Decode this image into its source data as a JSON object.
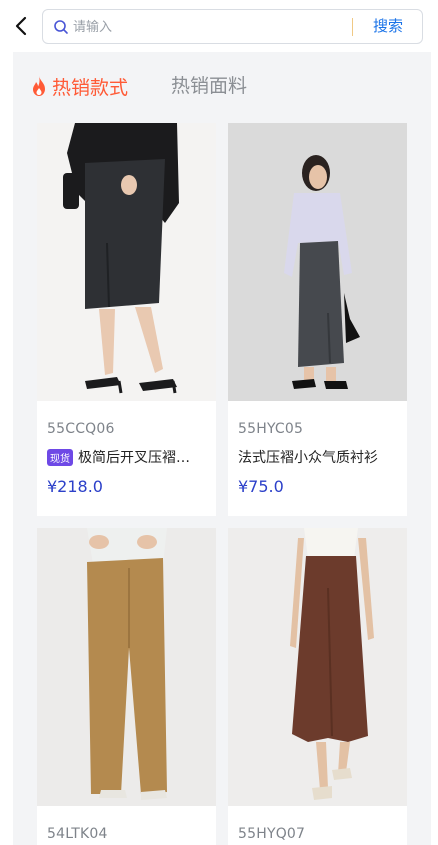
{
  "search": {
    "placeholder": "请输入",
    "button_label": "搜索"
  },
  "tabs": [
    {
      "label": "热销款式",
      "active": true,
      "icon": "fire-icon"
    },
    {
      "label": "热销面料",
      "active": false
    }
  ],
  "colors": {
    "accent": "#ff5a36",
    "price": "#2c40c9",
    "badge": "#6e49e6",
    "link": "#1a73e8"
  },
  "products": [
    {
      "code": "55CCQ06",
      "badge": "现货",
      "name": "极简后开叉压褶…",
      "price": "¥218.0"
    },
    {
      "code": "55HYC05",
      "badge": "",
      "name": "法式压褶小众气质衬衫",
      "price": "¥75.0"
    },
    {
      "code": "54LTK04"
    },
    {
      "code": "55HYQ07"
    }
  ]
}
